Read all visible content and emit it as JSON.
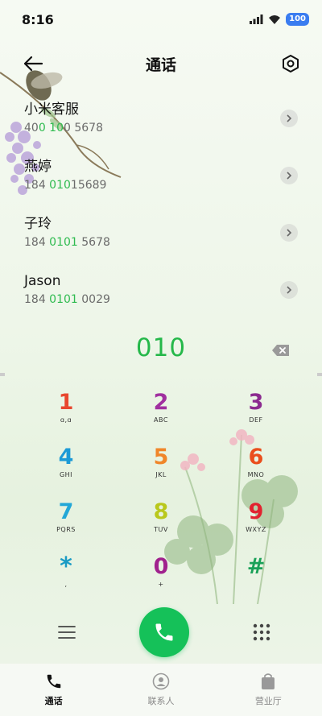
{
  "status_bar": {
    "time": "8:16",
    "battery": "100",
    "icons": [
      "signal-icon",
      "wifi-icon",
      "battery-icon"
    ]
  },
  "header": {
    "title": "通话",
    "back_icon": "back-arrow-icon",
    "settings_icon": "settings-hexagon-icon"
  },
  "contacts": [
    {
      "name": "小米客服",
      "number_parts": [
        "40",
        "0 10",
        "0 5678"
      ]
    },
    {
      "name": "燕婷",
      "number_parts": [
        "184 ",
        "010",
        "15689"
      ]
    },
    {
      "name": "子玲",
      "number_parts": [
        "184 ",
        "0101",
        " 5678"
      ]
    },
    {
      "name": "Jason",
      "number_parts": [
        "184 ",
        "0101",
        " 0029"
      ]
    }
  ],
  "dialed_number": "010",
  "keypad": [
    [
      {
        "digit": "1",
        "letters": "ɑ,ɑ",
        "color": "#e8472f"
      },
      {
        "digit": "2",
        "letters": "ABC",
        "color": "#a02f9f"
      },
      {
        "digit": "3",
        "letters": "DEF",
        "color": "#8b2a8f"
      }
    ],
    [
      {
        "digit": "4",
        "letters": "GHI",
        "color": "#1c9ad6"
      },
      {
        "digit": "5",
        "letters": "JKL",
        "color": "#f0862a"
      },
      {
        "digit": "6",
        "letters": "MNO",
        "color": "#ea4e1c"
      }
    ],
    [
      {
        "digit": "7",
        "letters": "PQRS",
        "color": "#22a7d7"
      },
      {
        "digit": "8",
        "letters": "TUV",
        "color": "#b9c81c"
      },
      {
        "digit": "9",
        "letters": "WXYZ",
        "color": "#e2222f"
      }
    ],
    [
      {
        "digit": "*",
        "letters": ",",
        "color": "#1a9bc4"
      },
      {
        "digit": "0",
        "letters": "+",
        "color": "#a0218d"
      },
      {
        "digit": "#",
        "letters": "",
        "color": "#1aa158"
      }
    ]
  ],
  "actions": {
    "menu_icon": "menu-icon",
    "call_icon": "phone-icon",
    "keypad_icon": "dialpad-icon"
  },
  "bottom_nav": [
    {
      "label": "通话",
      "icon": "phone-icon",
      "active": true
    },
    {
      "label": "联系人",
      "icon": "contacts-icon",
      "active": false
    },
    {
      "label": "营业厅",
      "icon": "store-bag-icon",
      "active": false
    }
  ],
  "colors": {
    "accent_green": "#2fbb50",
    "call_button": "#15c159",
    "battery_blue": "#3a7cf0"
  }
}
